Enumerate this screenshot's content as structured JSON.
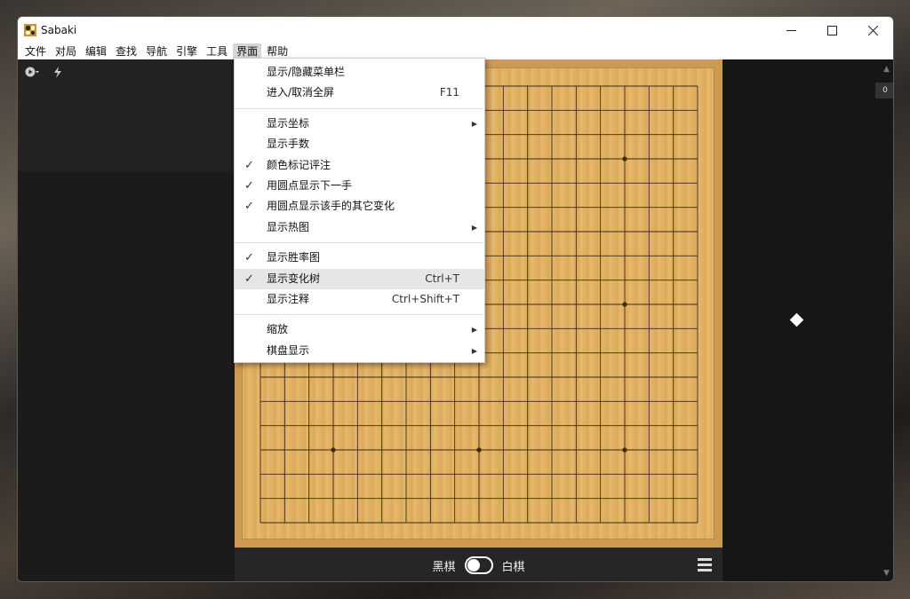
{
  "window": {
    "title": "Sabaki"
  },
  "menubar": {
    "items": [
      "文件",
      "对局",
      "编辑",
      "查找",
      "导航",
      "引擎",
      "工具",
      "界面",
      "帮助"
    ],
    "active_index": 7
  },
  "view_menu": {
    "items": [
      {
        "label": "显示/隐藏菜单栏",
        "shortcut": "",
        "checked": false,
        "submenu": false
      },
      {
        "label": "进入/取消全屏",
        "shortcut": "F11",
        "checked": false,
        "submenu": false
      },
      {
        "label": "显示坐标",
        "shortcut": "",
        "checked": false,
        "submenu": true
      },
      {
        "label": "显示手数",
        "shortcut": "",
        "checked": false,
        "submenu": false
      },
      {
        "label": "颜色标记评注",
        "shortcut": "",
        "checked": true,
        "submenu": false
      },
      {
        "label": "用圆点显示下一手",
        "shortcut": "",
        "checked": true,
        "submenu": false
      },
      {
        "label": "用圆点显示该手的其它变化",
        "shortcut": "",
        "checked": true,
        "submenu": false
      },
      {
        "label": "显示热图",
        "shortcut": "",
        "checked": false,
        "submenu": true
      },
      {
        "label": "显示胜率图",
        "shortcut": "",
        "checked": true,
        "submenu": false
      },
      {
        "label": "显示变化树",
        "shortcut": "Ctrl+T",
        "checked": true,
        "submenu": false,
        "hover": true
      },
      {
        "label": "显示注释",
        "shortcut": "Ctrl+Shift+T",
        "checked": false,
        "submenu": false
      },
      {
        "label": "缩放",
        "shortcut": "",
        "checked": false,
        "submenu": true
      },
      {
        "label": "棋盘显示",
        "shortcut": "",
        "checked": false,
        "submenu": true
      }
    ],
    "check_glyph": "✓",
    "arrow_glyph": "▶"
  },
  "player_bar": {
    "black_label": "黑棋",
    "white_label": "白棋"
  },
  "game_tree": {
    "move_number": "0"
  },
  "colors": {
    "board": "#e0b063",
    "board_border": "#cc9a52",
    "panel": "#1b1b1b",
    "menu_hover": "#e6e6e6"
  },
  "icons": [
    "play-icon",
    "lightning-icon",
    "minimize-icon",
    "maximize-icon",
    "close-icon",
    "hamburger-icon"
  ]
}
